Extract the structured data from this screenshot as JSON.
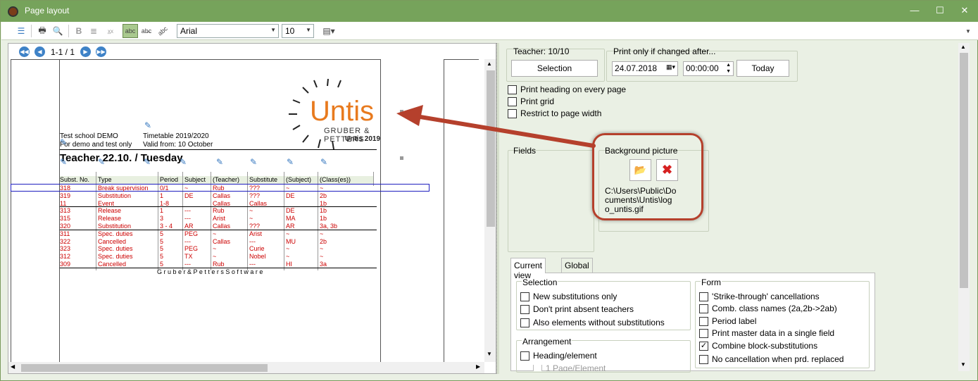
{
  "window": {
    "title": "Page layout",
    "minimize": "—",
    "maximize": "☐",
    "close": "✕"
  },
  "toolbar": {
    "font": "Arial",
    "size": "10",
    "bold": "B",
    "abc": "abc"
  },
  "preview": {
    "pageinfo": "1-1 / 1",
    "school": "Test school  DEMO",
    "timetable": "Timetable 2019/2020",
    "demo": "For demo and test only",
    "valid": "Valid from: 10 October",
    "heading": "Teacher  22.10. / Tuesday",
    "logo": "Untis",
    "logo_sub": "GRUBER & PETTERS",
    "logo_year": "Untis 2019",
    "footer": "G r u b e r  &  P e t t e r s  S o f t w a r e",
    "columns": [
      "Subst. No.",
      "Type",
      "Period",
      "Subject",
      "(Teacher)",
      "Substitute",
      "(Subject)",
      "(Class(es))"
    ],
    "rows": [
      [
        "318",
        "Break supervision",
        "0/1",
        "~",
        "Rub",
        "???",
        "~",
        "~"
      ],
      [
        "319",
        "Substitution",
        "1",
        "DE",
        "Callas",
        "???",
        "DE",
        "2b"
      ],
      [
        "11",
        "Event",
        "1-8",
        "",
        "Callas",
        "Callas",
        "",
        "1b"
      ],
      [
        "313",
        "Release",
        "1",
        "---",
        "Rub",
        "~",
        "DE",
        "1b"
      ],
      [
        "315",
        "Release",
        "3",
        "---",
        "Arist",
        "~",
        "MA",
        "1b"
      ],
      [
        "320",
        "Substitution",
        "3 - 4",
        "AR",
        "Callas",
        "???",
        "AR",
        "3a, 3b"
      ],
      [
        "311",
        "Spec. duties",
        "5",
        "PEG",
        "~",
        "Arist",
        "~",
        "~"
      ],
      [
        "322",
        "Cancelled",
        "5",
        "---",
        "Callas",
        "---",
        "MU",
        "2b"
      ],
      [
        "323",
        "Spec. duties",
        "5",
        "PEG",
        "~",
        "Curie",
        "~",
        "~"
      ],
      [
        "312",
        "Spec. duties",
        "5",
        "TX",
        "~",
        "Nobel",
        "~",
        "~"
      ],
      [
        "309",
        "Cancelled",
        "5",
        "---",
        "Rub",
        "---",
        "HI",
        "3a"
      ]
    ]
  },
  "settings": {
    "teacher_label": "Teacher: 10/10",
    "selection_button": "Selection",
    "print_only_label": "Print only if changed after...",
    "date": "24.07.2018",
    "time": "00:00:00",
    "today_button": "Today",
    "checks_top": [
      {
        "label": "Print heading on every page",
        "checked": false
      },
      {
        "label": "Print grid",
        "checked": false
      },
      {
        "label": "Restrict to page width",
        "checked": false
      }
    ],
    "fields_label": "Fields",
    "bg_label": "Background picture",
    "bg_path_1": "C:\\Users\\Public\\Do",
    "bg_path_2": "cuments\\Untis\\log",
    "bg_path_3": "o_untis.gif",
    "tabs": [
      "Current view",
      "Global"
    ],
    "selection_label": "Selection",
    "selection_checks": [
      {
        "label": "New substitutions only",
        "checked": false
      },
      {
        "label": "Don't print absent teachers",
        "checked": false
      },
      {
        "label": "Also elements without substitutions",
        "checked": false
      }
    ],
    "arrangement_label": "Arrangement",
    "arrangement_checks": [
      {
        "label": "Heading/element",
        "checked": false
      },
      {
        "label": "1 Page/Element",
        "checked": false
      }
    ],
    "form_label": "Form",
    "form_checks": [
      {
        "label": "'Strike-through' cancellations",
        "checked": false
      },
      {
        "label": "Comb. class names (2a,2b->2ab)",
        "checked": false
      },
      {
        "label": "Period label",
        "checked": false
      },
      {
        "label": "Print master data in a single field",
        "checked": false
      },
      {
        "label": "Combine block-substitutions",
        "checked": true
      },
      {
        "label": "No cancellation when prd. replaced",
        "checked": false
      }
    ]
  },
  "colors": {
    "titlebar": "#76a35b",
    "annotation": "#b5402c",
    "row_text": "#cc0000",
    "highlight": "#1f1fbf"
  }
}
